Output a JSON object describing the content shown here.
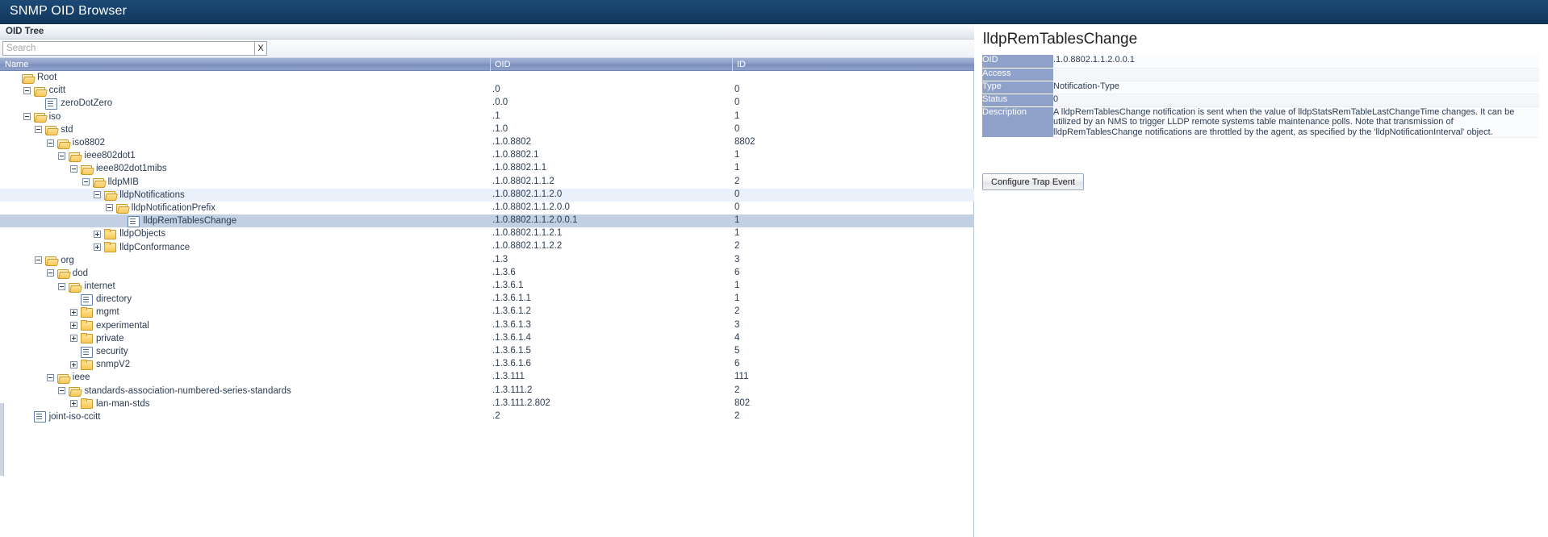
{
  "window": {
    "title": "SNMP OID Browser"
  },
  "left_panel": {
    "header_label": "OID Tree",
    "search": {
      "placeholder": "Search",
      "value": "",
      "clear_label": "X"
    },
    "columns": [
      {
        "key": "name",
        "label": "Name"
      },
      {
        "key": "oid",
        "label": "OID"
      },
      {
        "key": "id",
        "label": "ID"
      }
    ],
    "rows": [
      {
        "name": "Root",
        "oid": "",
        "id": "",
        "depth": 0,
        "icon": "folder-open-icon",
        "expander": "none",
        "state": "normal"
      },
      {
        "name": "ccitt",
        "oid": ".0",
        "id": "0",
        "depth": 1,
        "icon": "folder-open-icon",
        "expander": "minus",
        "state": "normal"
      },
      {
        "name": "zeroDotZero",
        "oid": ".0.0",
        "id": "0",
        "depth": 2,
        "icon": "leaf-icon",
        "expander": "none",
        "state": "normal"
      },
      {
        "name": "iso",
        "oid": ".1",
        "id": "1",
        "depth": 1,
        "icon": "folder-open-icon",
        "expander": "minus",
        "state": "normal"
      },
      {
        "name": "std",
        "oid": ".1.0",
        "id": "0",
        "depth": 2,
        "icon": "folder-open-icon",
        "expander": "minus",
        "state": "normal"
      },
      {
        "name": "iso8802",
        "oid": ".1.0.8802",
        "id": "8802",
        "depth": 3,
        "icon": "folder-open-icon",
        "expander": "minus",
        "state": "normal"
      },
      {
        "name": "ieee802dot1",
        "oid": ".1.0.8802.1",
        "id": "1",
        "depth": 4,
        "icon": "folder-open-icon",
        "expander": "minus",
        "state": "normal"
      },
      {
        "name": "ieee802dot1mibs",
        "oid": ".1.0.8802.1.1",
        "id": "1",
        "depth": 5,
        "icon": "folder-open-icon",
        "expander": "minus",
        "state": "normal"
      },
      {
        "name": "lldpMIB",
        "oid": ".1.0.8802.1.1.2",
        "id": "2",
        "depth": 6,
        "icon": "folder-open-icon",
        "expander": "minus",
        "state": "normal"
      },
      {
        "name": "lldpNotifications",
        "oid": ".1.0.8802.1.1.2.0",
        "id": "0",
        "depth": 7,
        "icon": "folder-open-icon",
        "expander": "minus",
        "state": "hover"
      },
      {
        "name": "lldpNotificationPrefix",
        "oid": ".1.0.8802.1.1.2.0.0",
        "id": "0",
        "depth": 8,
        "icon": "folder-open-icon",
        "expander": "minus",
        "state": "normal"
      },
      {
        "name": "lldpRemTablesChange",
        "oid": ".1.0.8802.1.1.2.0.0.1",
        "id": "1",
        "depth": 9,
        "icon": "leaf-icon",
        "expander": "none",
        "state": "selected"
      },
      {
        "name": "lldpObjects",
        "oid": ".1.0.8802.1.1.2.1",
        "id": "1",
        "depth": 7,
        "icon": "folder-closed-icon",
        "expander": "plus",
        "state": "normal"
      },
      {
        "name": "lldpConformance",
        "oid": ".1.0.8802.1.1.2.2",
        "id": "2",
        "depth": 7,
        "icon": "folder-closed-icon",
        "expander": "plus",
        "state": "normal"
      },
      {
        "name": "org",
        "oid": ".1.3",
        "id": "3",
        "depth": 2,
        "icon": "folder-open-icon",
        "expander": "minus",
        "state": "normal"
      },
      {
        "name": "dod",
        "oid": ".1.3.6",
        "id": "6",
        "depth": 3,
        "icon": "folder-open-icon",
        "expander": "minus",
        "state": "normal"
      },
      {
        "name": "internet",
        "oid": ".1.3.6.1",
        "id": "1",
        "depth": 4,
        "icon": "folder-open-icon",
        "expander": "minus",
        "state": "normal"
      },
      {
        "name": "directory",
        "oid": ".1.3.6.1.1",
        "id": "1",
        "depth": 5,
        "icon": "leaf-icon",
        "expander": "none",
        "state": "normal"
      },
      {
        "name": "mgmt",
        "oid": ".1.3.6.1.2",
        "id": "2",
        "depth": 5,
        "icon": "folder-closed-icon",
        "expander": "plus",
        "state": "normal"
      },
      {
        "name": "experimental",
        "oid": ".1.3.6.1.3",
        "id": "3",
        "depth": 5,
        "icon": "folder-closed-icon",
        "expander": "plus",
        "state": "normal"
      },
      {
        "name": "private",
        "oid": ".1.3.6.1.4",
        "id": "4",
        "depth": 5,
        "icon": "folder-closed-icon",
        "expander": "plus",
        "state": "normal"
      },
      {
        "name": "security",
        "oid": ".1.3.6.1.5",
        "id": "5",
        "depth": 5,
        "icon": "leaf-icon",
        "expander": "none",
        "state": "normal"
      },
      {
        "name": "snmpV2",
        "oid": ".1.3.6.1.6",
        "id": "6",
        "depth": 5,
        "icon": "folder-closed-icon",
        "expander": "plus",
        "state": "normal"
      },
      {
        "name": "ieee",
        "oid": ".1.3.111",
        "id": "111",
        "depth": 3,
        "icon": "folder-open-icon",
        "expander": "minus",
        "state": "normal"
      },
      {
        "name": "standards-association-numbered-series-standards",
        "oid": ".1.3.111.2",
        "id": "2",
        "depth": 4,
        "icon": "folder-open-icon",
        "expander": "minus",
        "state": "normal"
      },
      {
        "name": "lan-man-stds",
        "oid": ".1.3.111.2.802",
        "id": "802",
        "depth": 5,
        "icon": "folder-closed-icon",
        "expander": "plus",
        "state": "normal"
      },
      {
        "name": "joint-iso-ccitt",
        "oid": ".2",
        "id": "2",
        "depth": 1,
        "icon": "leaf-icon",
        "expander": "none",
        "state": "normal"
      }
    ]
  },
  "detail_panel": {
    "title": "lldpRemTablesChange",
    "fields": [
      {
        "label": "OID",
        "value": ".1.0.8802.1.1.2.0.0.1"
      },
      {
        "label": "Access",
        "value": ""
      },
      {
        "label": "Type",
        "value": "Notification-Type"
      },
      {
        "label": "Status",
        "value": "0"
      },
      {
        "label": "Description",
        "value": "A lldpRemTablesChange notification is sent when the value of lldpStatsRemTableLastChangeTime changes. It can be utilized by an NMS to trigger LLDP remote systems table maintenance polls. Note that transmission of lldpRemTablesChange notifications are throttled by the agent, as specified by the 'lldpNotificationInterval' object."
      }
    ],
    "configure_button_label": "Configure Trap Event"
  },
  "colors": {
    "titlebar": "#17406a",
    "grid_header": "#8b9dc7",
    "selected_row": "#c3d0e4",
    "hover_row": "#eaf1fa",
    "detail_label": "#8fa1c9",
    "folder": "#fbd572"
  }
}
